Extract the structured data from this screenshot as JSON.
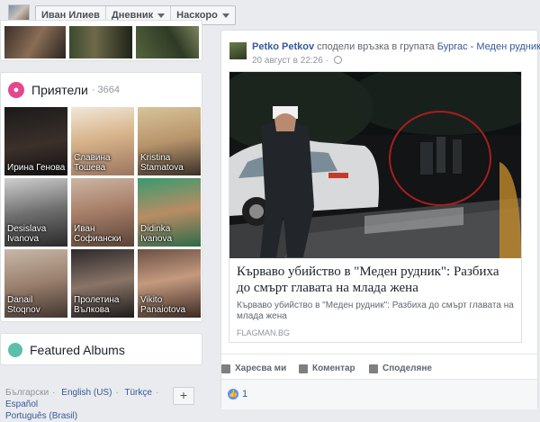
{
  "topbar": {
    "profile_name": "Иван Илиев",
    "menu_diary": "Дневник",
    "menu_recent": "Наскоро"
  },
  "friends": {
    "title": "Приятели",
    "count": "· 3664",
    "items": [
      {
        "name": "Ирина Генова"
      },
      {
        "name": "Славина Тошева"
      },
      {
        "name": "Kristina Stamatova"
      },
      {
        "name": "Desislava Ivanova"
      },
      {
        "name": "Иван Софиански"
      },
      {
        "name": "Didinka Ivanova"
      },
      {
        "name": "Danail Stoqnov"
      },
      {
        "name": "Пролетина Вълкова"
      },
      {
        "name": "Vikito Panaiotova"
      }
    ]
  },
  "albums": {
    "title": "Featured Albums"
  },
  "languages": {
    "items": [
      "Български",
      "English (US)",
      "Türkçe",
      "Español",
      "Português (Brasil)"
    ],
    "more": "+"
  },
  "post": {
    "author": "Petko Petkov",
    "action_text": "сподели връзка в групата",
    "group": "Бургас - Меден рудник",
    "date": "20 август в 22:26",
    "date_sep": "·",
    "link": {
      "title": "Кърваво убийство в \"Меден рудник\": Разбиха до смърт главата на млада жена",
      "description": "Кърваво убийство в \"Меден рудник\": Разбиха до смърт главата на млада жена",
      "source": "FLAGMAN.BG"
    },
    "actions": {
      "like": "Харесва ми",
      "comment": "Коментар",
      "share": "Споделяне"
    },
    "reactions": {
      "like_count": "1"
    }
  }
}
